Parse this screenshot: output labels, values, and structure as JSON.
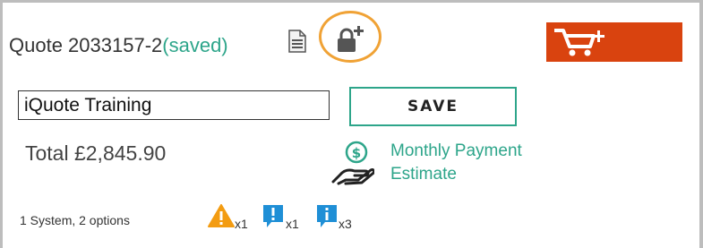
{
  "quote": {
    "title": "Quote 2033157-2",
    "status": "(saved)",
    "name_value": "iQuote Training",
    "save_label": "SAVE",
    "total": "Total £2,845.90"
  },
  "icons": {
    "document": "document-icon",
    "lock_add": "lock-add-icon",
    "cart_add": "cart-add-icon",
    "payment": "hand-coin-icon"
  },
  "payment_estimate": {
    "line1": "Monthly Payment",
    "line2": "Estimate"
  },
  "summary": {
    "text": "1 System, 2 options"
  },
  "alerts": {
    "warning_count": "x1",
    "error_count": "x1",
    "info_count": "x3"
  },
  "colors": {
    "accent_teal": "#2da58a",
    "cart_orange": "#d9430f",
    "highlight_ring": "#f0a235",
    "warning": "#f39c12",
    "info_blue": "#1f8fd6"
  }
}
